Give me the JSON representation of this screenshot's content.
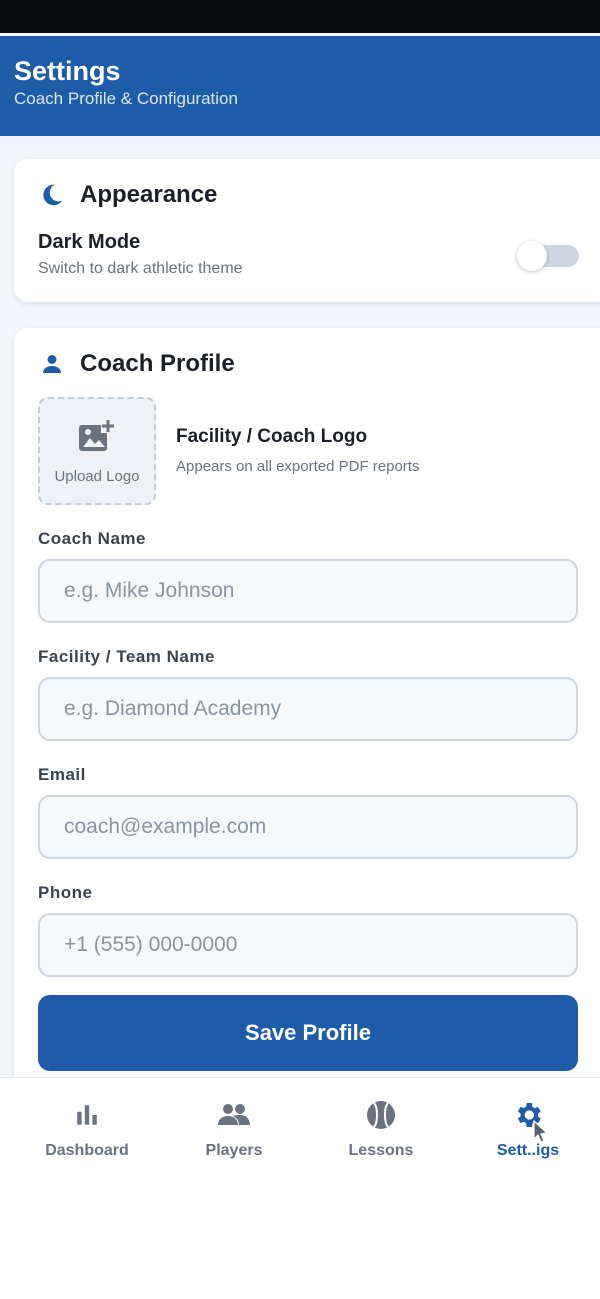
{
  "header": {
    "title": "Settings",
    "subtitle": "Coach Profile & Configuration"
  },
  "appearance": {
    "icon": "moon-icon",
    "title": "Appearance",
    "dark_mode_label": "Dark Mode",
    "dark_mode_sub": "Switch to dark athletic theme",
    "dark_mode_enabled": false
  },
  "profile": {
    "icon": "user-icon",
    "title": "Coach Profile",
    "logo": {
      "icon": "add-photo-icon",
      "upload_label": "Upload Logo",
      "title": "Facility / Coach Logo",
      "sub": "Appears on all exported PDF reports"
    },
    "fields": [
      {
        "label": "Coach Name",
        "placeholder": "e.g. Mike Johnson",
        "value": ""
      },
      {
        "label": "Facility / Team Name",
        "placeholder": "e.g. Diamond Academy",
        "value": ""
      },
      {
        "label": "Email",
        "placeholder": "coach@example.com",
        "value": ""
      },
      {
        "label": "Phone",
        "placeholder": "+1 (555) 000-0000",
        "value": ""
      }
    ],
    "save_label": "Save Profile"
  },
  "nav": {
    "items": [
      {
        "label": "Dashboard",
        "icon": "bar-chart-icon"
      },
      {
        "label": "Players",
        "icon": "group-icon"
      },
      {
        "label": "Lessons",
        "icon": "baseball-icon"
      },
      {
        "label": "Sett..igs",
        "icon": "gear-icon"
      }
    ],
    "active_index": 3
  },
  "colors": {
    "primary": "#1e5ca8",
    "muted": "#6b7280"
  }
}
